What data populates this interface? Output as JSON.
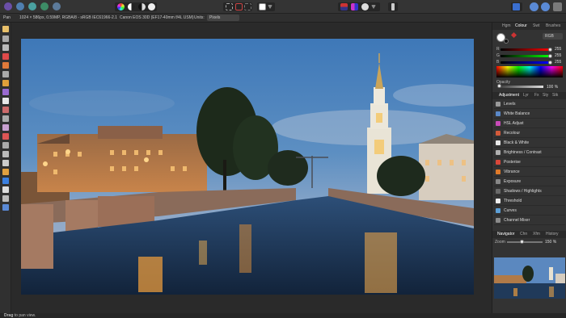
{
  "toolbar": {
    "personas": [
      "photo-persona",
      "liquify-persona",
      "develop-persona",
      "tone-mapping-persona",
      "export-persona"
    ],
    "accent_color": "#e6432f"
  },
  "context": {
    "tool_name": "Pan",
    "doc_info": "1024 × 586px, 0.59MP, RGBA/8 - sRGB IEC61966-2.1",
    "camera": "Canon EOS 30D (EF17-40mm f/4L USM)",
    "units_label": "Units:",
    "units_value": "Pixels"
  },
  "panel": {
    "top_tabs": [
      "Hgm",
      "Colour",
      "Swt",
      "Brushes"
    ],
    "colour_mode": "RGB",
    "channels": [
      {
        "label": "R",
        "value": "255"
      },
      {
        "label": "G",
        "value": "255"
      },
      {
        "label": "B",
        "value": "255"
      }
    ],
    "opacity_label": "Opacity",
    "opacity_value": "100 %",
    "adj_tabs": [
      "Adjustment",
      "Lyr",
      "Fx",
      "Sty",
      "Stk"
    ],
    "adjustments": [
      {
        "label": "Levels",
        "color": "#9a9a9a"
      },
      {
        "label": "White Balance",
        "color": "#5a88c8"
      },
      {
        "label": "HSL Adjust",
        "color": "#c84bb8"
      },
      {
        "label": "Recolour",
        "color": "#d45a3a"
      },
      {
        "label": "Black & White",
        "color": "#e8e8e8"
      },
      {
        "label": "Brightness / Contrast",
        "color": "#b0b0b0"
      },
      {
        "label": "Posterise",
        "color": "#d9473a"
      },
      {
        "label": "Vibrance",
        "color": "#e07a2a"
      },
      {
        "label": "Exposure",
        "color": "#888888"
      },
      {
        "label": "Shadows / Highlights",
        "color": "#6a6a6a"
      },
      {
        "label": "Threshold",
        "color": "#eeeeee"
      },
      {
        "label": "Curves",
        "color": "#5d9fd6"
      },
      {
        "label": "Channel Mixer",
        "color": "#8a8a8a"
      }
    ],
    "nav_tabs": [
      "Navigator",
      "Chn",
      "Xfm",
      "History"
    ],
    "zoom_label": "Zoom",
    "zoom_value": "150 %"
  },
  "status": {
    "hint_bold": "Drag",
    "hint_rest": "to pan view."
  }
}
